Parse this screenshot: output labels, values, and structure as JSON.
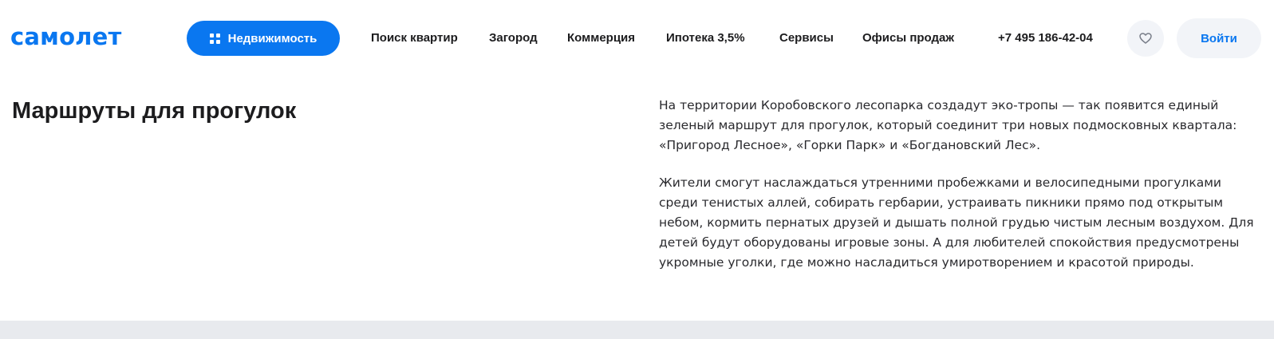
{
  "header": {
    "logo": "самолет",
    "realty_button": "Недвижимость",
    "nav": [
      {
        "label": "Поиск квартир"
      },
      {
        "label": "Загород"
      },
      {
        "label": "Коммерция"
      },
      {
        "label": "Ипотека 3,5%"
      },
      {
        "label": "Сервисы"
      },
      {
        "label": "Офисы продаж"
      }
    ],
    "phone": "+7 495 186-42-04",
    "login_button": "Войти"
  },
  "main": {
    "title": "Маршруты для прогулок",
    "paragraphs": [
      "На территории Коробовского лесопарка создадут эко-тропы — так появится единый зеленый маршрут для прогулок, который соединит три новых подмосковных квартала: «Пригород Лесное», «Горки Парк» и «Богдановский Лес».",
      "Жители смогут наслаждаться утренними пробежками и велосипедными прогулками среди тенистых аллей, собирать гербарии, устраивать пикники прямо под открытым небом, кормить пернатых друзей и дышать полной грудью чистым лесным воздухом. Для детей будут оборудованы игровые зоны. А для любителей спокойствия предусмотрены укромные уголки, где можно насладиться умиротворением и красотой природы."
    ]
  },
  "colors": {
    "brand": "#0a77f0",
    "button_bg_light": "#f2f4f8",
    "footer_band": "#e8eaee"
  },
  "icons": {
    "realty": "grid-icon",
    "favorites": "heart-icon"
  }
}
